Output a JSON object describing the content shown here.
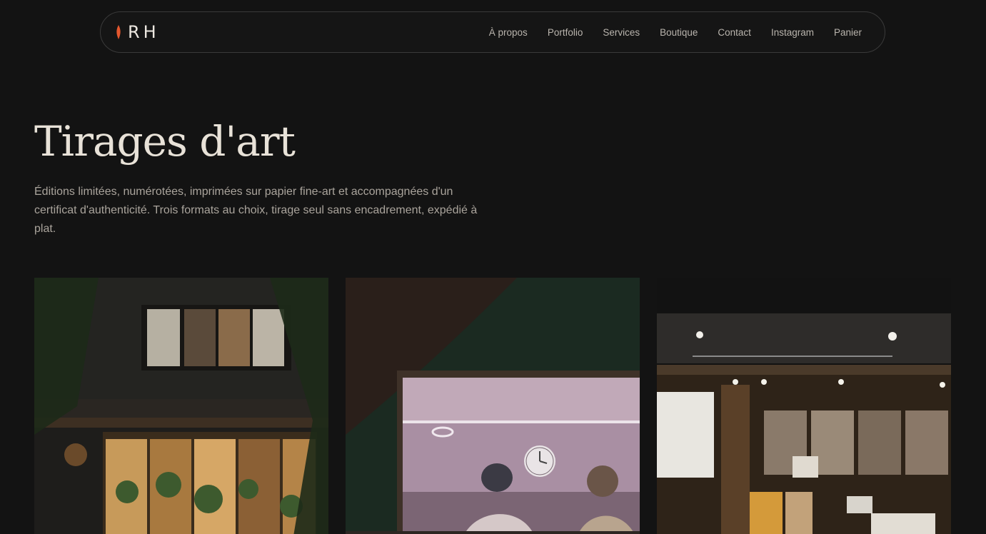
{
  "header": {
    "logo_text": "RH",
    "nav_items": [
      {
        "label": "À propos"
      },
      {
        "label": "Portfolio"
      },
      {
        "label": "Services"
      },
      {
        "label": "Boutique"
      },
      {
        "label": "Contact"
      },
      {
        "label": "Instagram"
      },
      {
        "label": "Panier"
      }
    ]
  },
  "hero": {
    "title": "Tirages d'art",
    "description": "Éditions limitées, numérotées, imprimées sur papier fine-art et accompagnées d'un certificat d'authenticité. Trois formats au choix, tirage seul sans encadrement, expédié à plat."
  },
  "gallery": {
    "images": [
      {
        "icon": "storefront-night-photo"
      },
      {
        "icon": "window-clock-photo"
      },
      {
        "icon": "izakaya-facade-photo"
      }
    ]
  },
  "colors": {
    "background": "#131313",
    "accent": "#e4572e",
    "text": "#e8e2d8"
  }
}
